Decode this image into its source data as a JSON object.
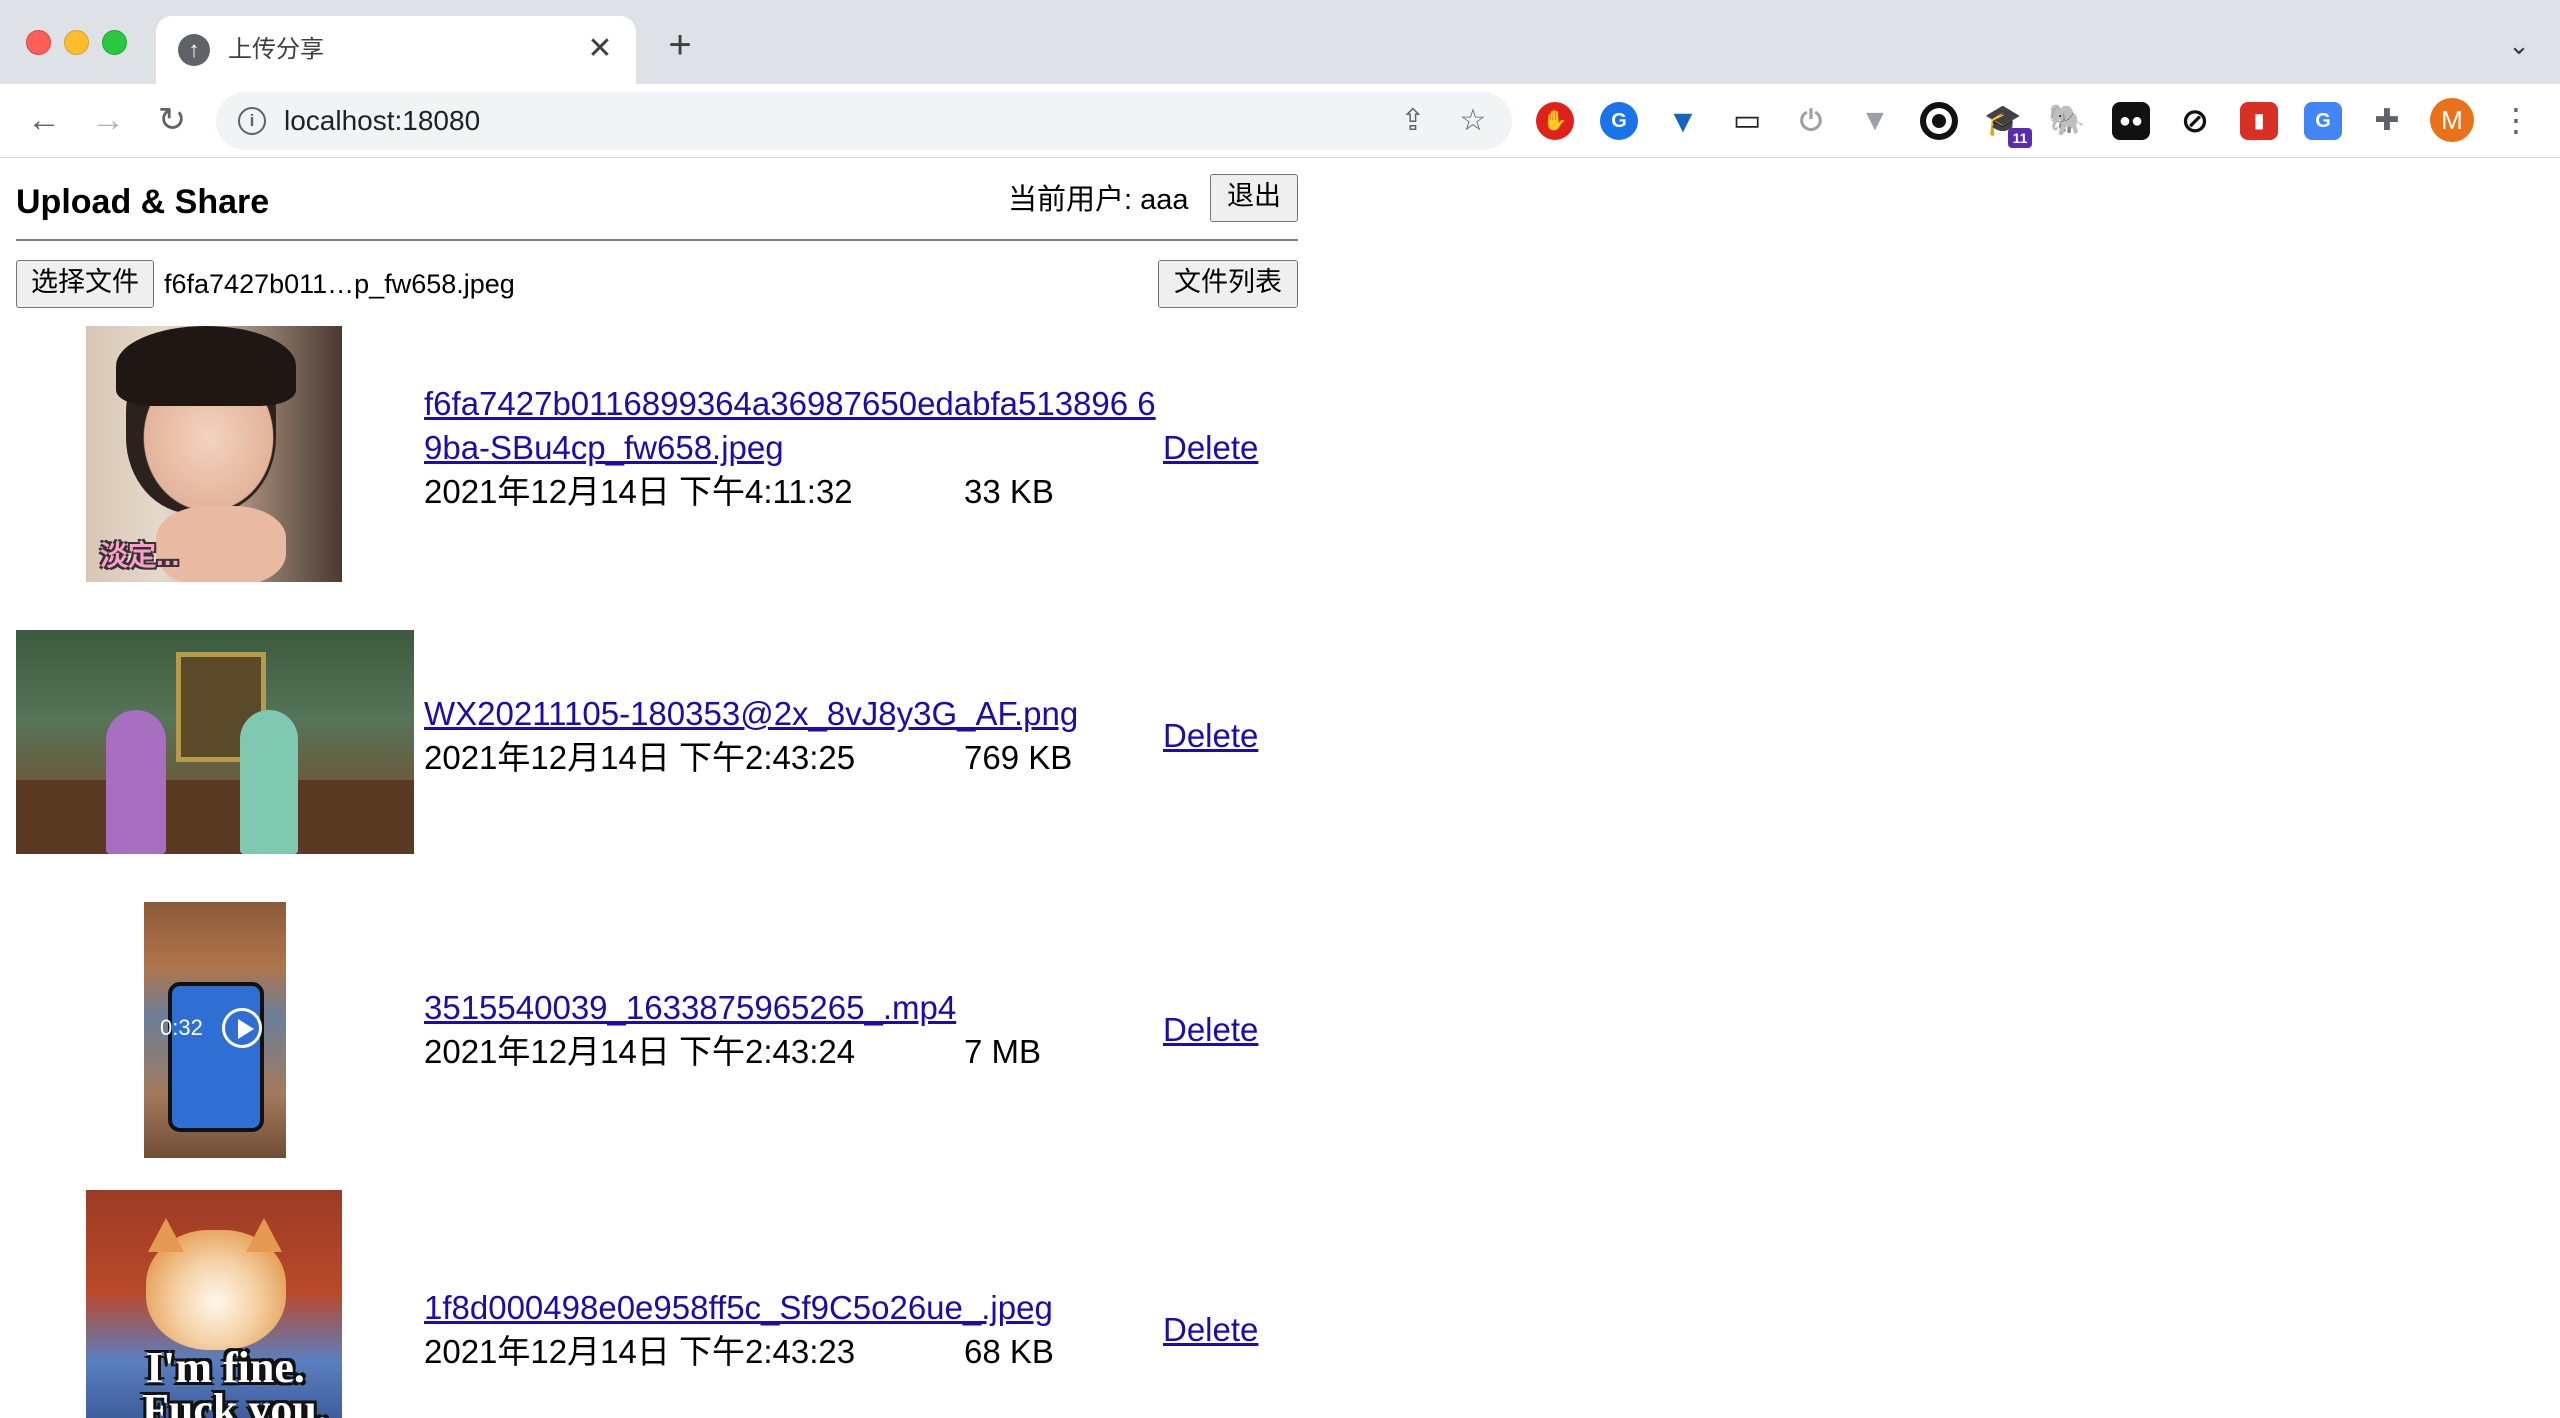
{
  "browser": {
    "tab_title": "上传分享",
    "tab_favicon": "upload-arrow-icon",
    "url": "localhost:18080",
    "new_tab": "+",
    "close": "✕",
    "extension_badge": "11",
    "profile_initial": "M"
  },
  "app": {
    "title": "Upload & Share",
    "current_user_label": "当前用户: aaa",
    "logout_label": "退出",
    "choose_file_label": "选择文件",
    "chosen_file_name": "f6fa7427b011…p_fw658.jpeg",
    "file_list_label": "文件列表"
  },
  "files": [
    {
      "name": "f6fa7427b0116899364a36987650edabfa513896 69ba-SBu4cp_fw658.jpeg",
      "date": "2021年12月14日 下午4:11:32",
      "size": "33 KB",
      "delete_label": "Delete",
      "thumb_caption": "淡定..."
    },
    {
      "name": "WX20211105-180353@2x_8vJ8y3G_AF.png",
      "date": "2021年12月14日 下午2:43:25",
      "size": "769 KB",
      "delete_label": "Delete"
    },
    {
      "name": "3515540039_1633875965265_.mp4",
      "date": "2021年12月14日 下午2:43:24",
      "size": "7 MB",
      "delete_label": "Delete",
      "video_duration": "0:32"
    },
    {
      "name": "1f8d000498e0e958ff5c_Sf9C5o26ue_.jpeg",
      "date": "2021年12月14日 下午2:43:23",
      "size": "68 KB",
      "delete_label": "Delete",
      "thumb_caption_1": "I'm fine.",
      "thumb_caption_2": "Fuck you."
    }
  ]
}
